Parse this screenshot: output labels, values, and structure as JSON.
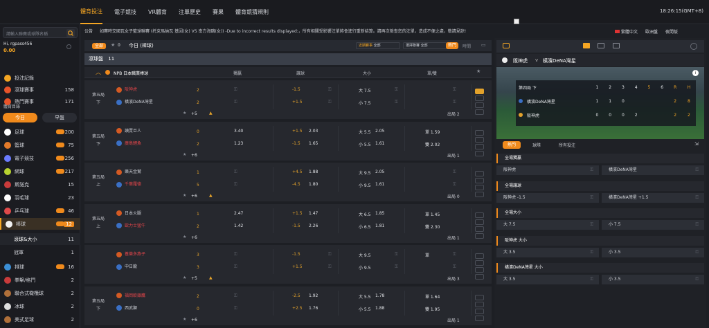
{
  "topnav": {
    "items": [
      "體育投注",
      "電子競技",
      "VR體育",
      "注單歷史",
      "賽果",
      "體育競猜規則"
    ],
    "clock": "18:26:15(GMT+8)"
  },
  "sidebar": {
    "search_placeholder": "請輸入聯賽或球隊名稱",
    "user": "Hi, rgpass456",
    "balance": "0.00",
    "links": [
      {
        "label": "投注記錄",
        "count": ""
      },
      {
        "label": "滾球賽事",
        "count": "158"
      },
      {
        "label": "熱門賽事",
        "count": "171"
      }
    ],
    "section": "體育目錄",
    "tabs": {
      "today": "今日",
      "early": "早盤"
    },
    "sports": [
      {
        "label": "足球",
        "count": "200",
        "hot": true,
        "color": "#ffffff"
      },
      {
        "label": "籃球",
        "count": "75",
        "hot": true,
        "color": "#e37a2a"
      },
      {
        "label": "電子競技",
        "count": "256",
        "hot": true,
        "color": "#6b7cff"
      },
      {
        "label": "網球",
        "count": "217",
        "hot": true,
        "color": "#b8d330"
      },
      {
        "label": "斯諾克",
        "count": "15",
        "hot": false,
        "color": "#c93b3b"
      },
      {
        "label": "羽毛球",
        "count": "23",
        "hot": false,
        "color": "#ffffff"
      },
      {
        "label": "乒乓球",
        "count": "46",
        "hot": true,
        "color": "#e04a4a"
      },
      {
        "label": "棒球",
        "count": "12",
        "hot": true,
        "color": "#f1f1f1"
      }
    ],
    "baseball_sub": [
      {
        "label": "滾球&大小",
        "count": "11"
      },
      {
        "label": "冠軍",
        "count": "1"
      }
    ],
    "sports2": [
      {
        "label": "排球",
        "count": "16",
        "hot": true,
        "color": "#3b8fd6"
      },
      {
        "label": "拳擊/格鬥",
        "count": "2",
        "hot": false,
        "color": "#c93b3b"
      },
      {
        "label": "聯合式橄欖球",
        "count": "2",
        "hot": false,
        "color": "#b0703a"
      },
      {
        "label": "冰球",
        "count": "2",
        "hot": false,
        "color": "#dddddd"
      },
      {
        "label": "美式足球",
        "count": "2",
        "hot": false,
        "color": "#b0703a"
      }
    ]
  },
  "notice": {
    "label": "公告",
    "text": "如賽時交國瓦女子籃球聯賽 (托克馬納瓦 基因(女) VS 南方海鷗(女)) -Due to incorrect results displayed:，所有相關受影響注單將會進行重新結算。請再次檢查您的注單，造成不便之處，敬請見諒!"
  },
  "top_right": {
    "lang": "繁體中文",
    "odds": "歐洲盤",
    "theme": "夜間版"
  },
  "filters": {
    "all": "全部",
    "star_count": "0",
    "title": "今日 (棒球)",
    "sort_label": "近期賽事",
    "sort_val": "全部",
    "league_label": "選擇聯賽",
    "league_val": "全部",
    "hot": "熱門",
    "time": "時間"
  },
  "main_header": {
    "label": "滾球盤",
    "count": "11"
  },
  "league": {
    "name": "NPB 日本職業棒球",
    "cols": [
      "獨贏",
      "讓球",
      "大小",
      "單/雙"
    ]
  },
  "matches": [
    {
      "when": [
        "第五局",
        "下"
      ],
      "home": "阪神虎",
      "away": "橫濱DeNA灣星",
      "hs": "2",
      "as": "2",
      "more": "+5",
      "ml": [
        "",
        ""
      ],
      "hdp": [
        {
          "line": "-1.5",
          "odds": ""
        },
        {
          "line": "+1.5",
          "odds": ""
        }
      ],
      "ou": [
        {
          "line": "大 7.5",
          "odds": ""
        },
        {
          "line": "小 7.5",
          "odds": ""
        }
      ],
      "oe": [
        "",
        ""
      ],
      "extra": "出局 2",
      "homeRed": true
    },
    {
      "when": [
        "第五局",
        "下"
      ],
      "home": "讀賣巨人",
      "away": "廣島鯉魚",
      "hs": "0",
      "as": "2",
      "more": "+6",
      "ml": [
        "3.40",
        "1.23"
      ],
      "hdp": [
        {
          "line": "+1.5",
          "odds": "2.03"
        },
        {
          "line": "-1.5",
          "odds": "1.65"
        }
      ],
      "ou": [
        {
          "line": "大 5.5",
          "odds": "2.05"
        },
        {
          "line": "小 5.5",
          "odds": "1.61"
        }
      ],
      "oe": [
        "單 1.59",
        "雙 2.02"
      ],
      "extra": "出局 1",
      "awayRed": true
    },
    {
      "when": [
        "第五局",
        "上"
      ],
      "home": "樂天金鷲",
      "away": "千葉羅德",
      "hs": "1",
      "as": "5",
      "more": "+6",
      "ml": [
        "",
        ""
      ],
      "hdp": [
        {
          "line": "+4.5",
          "odds": "1.88"
        },
        {
          "line": "-4.5",
          "odds": "1.80"
        }
      ],
      "ou": [
        {
          "line": "大 9.5",
          "odds": "2.05"
        },
        {
          "line": "小 9.5",
          "odds": "1.61"
        }
      ],
      "oe": [
        "",
        ""
      ],
      "extra": "出局 0",
      "awayRed": true
    },
    {
      "when": [
        "第五局",
        "上"
      ],
      "home": "日本火腿",
      "away": "歐力士猛牛",
      "hs": "1",
      "as": "2",
      "more": "+6",
      "ml": [
        "2.47",
        "1.42"
      ],
      "hdp": [
        {
          "line": "+1.5",
          "odds": "1.47"
        },
        {
          "line": "-1.5",
          "odds": "2.26"
        }
      ],
      "ou": [
        {
          "line": "大 6.5",
          "odds": "1.85"
        },
        {
          "line": "小 6.5",
          "odds": "1.81"
        }
      ],
      "oe": [
        "單 1.45",
        "雙 2.30"
      ],
      "extra": "出局 1",
      "awayRed": true
    },
    {
      "when": [
        "",
        ""
      ],
      "home": "養樂多燕子",
      "away": "中日龍",
      "hs": "3",
      "as": "3",
      "more": "+5",
      "ml": [
        "",
        ""
      ],
      "hdp": [
        {
          "line": "-1.5",
          "odds": ""
        },
        {
          "line": "+1.5",
          "odds": ""
        }
      ],
      "ou": [
        {
          "line": "大 9.5",
          "odds": ""
        },
        {
          "line": "小 9.5",
          "odds": ""
        }
      ],
      "oe": [
        "單",
        ""
      ],
      "extra": "出局 3",
      "homeRed": true
    },
    {
      "when": [
        "第五局",
        "下"
      ],
      "home": "福岡軟銀鷹",
      "away": "西武獅",
      "hs": "2",
      "as": "0",
      "more": "+6",
      "ml": [
        "",
        ""
      ],
      "hdp": [
        {
          "line": "-2.5",
          "odds": "1.92"
        },
        {
          "line": "+2.5",
          "odds": "1.76"
        }
      ],
      "ou": [
        {
          "line": "大 5.5",
          "odds": "1.78"
        },
        {
          "line": "小 5.5",
          "odds": "1.88"
        }
      ],
      "oe": [
        "單 1.64",
        "雙 1.95"
      ],
      "extra": "出局 1",
      "homeRed": true
    }
  ],
  "right": {
    "teams_home": "阪神虎",
    "vs": "v",
    "teams_away": "橫濱DeNA灣星",
    "score": {
      "period": "第四局 下",
      "innings": [
        "1",
        "2",
        "3",
        "4",
        "5",
        "6",
        "R",
        "H"
      ],
      "rows": [
        {
          "team": "橫濱DeNA灣星",
          "vals": [
            "1",
            "1",
            "0",
            "",
            "",
            "",
            "2",
            "8"
          ]
        },
        {
          "team": "阪神虎",
          "vals": [
            "0",
            "0",
            "0",
            "2",
            "",
            "",
            "2",
            "2"
          ]
        }
      ]
    },
    "tabs": [
      "熱門",
      "球隊",
      "所有投注"
    ],
    "markets": [
      {
        "title": "全場獨贏",
        "l": "阪神虎",
        "r": "橫濱DeNA灣星"
      },
      {
        "title": "全場讓球",
        "l": "阪神虎 -1.5",
        "r": "橫濱DeNA灣星 +1.5"
      },
      {
        "title": "全場大小",
        "l": "大 7.5",
        "r": "小 7.5"
      },
      {
        "title": "阪神虎 大小",
        "l": "大 3.5",
        "r": "小 3.5"
      },
      {
        "title": "橫濱DeNA灣星 大小",
        "l": "大 3.5",
        "r": "小 3.5"
      }
    ]
  }
}
